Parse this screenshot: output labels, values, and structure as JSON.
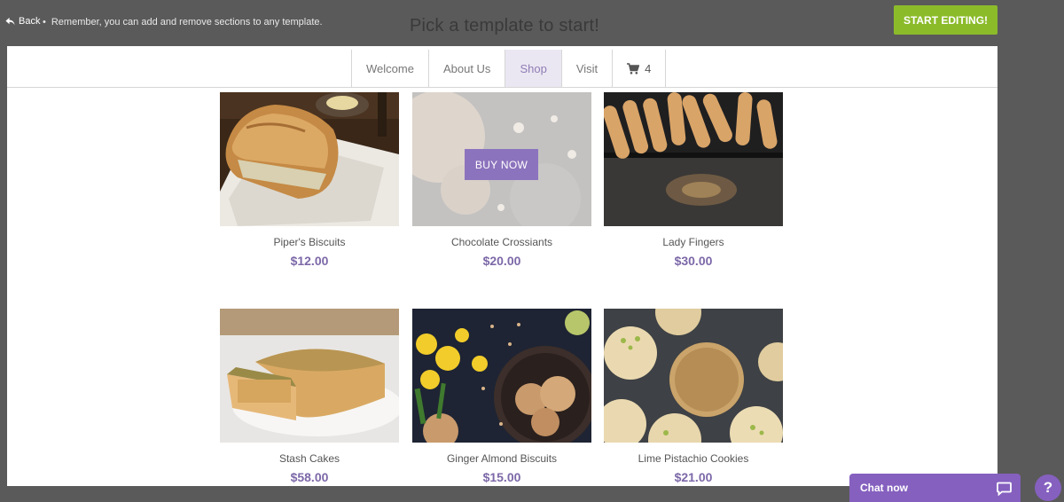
{
  "topbar": {
    "back_label": "Back",
    "hint_bullet": "•",
    "hint_text": "Remember, you can add and remove sections to any template.",
    "heading": "Pick a template to start!",
    "start_button": "START EDITING!"
  },
  "nav": {
    "items": [
      {
        "label": "Welcome"
      },
      {
        "label": "About Us"
      },
      {
        "label": "Shop"
      },
      {
        "label": "Visit"
      }
    ],
    "active": "Shop",
    "cart_count": "4"
  },
  "products": [
    {
      "name": "Piper's Biscuits",
      "price": "$12.00"
    },
    {
      "name": "Chocolate Crossiants",
      "price": "$20.00",
      "overlay_button": "BUY NOW"
    },
    {
      "name": "Lady Fingers",
      "price": "$30.00"
    },
    {
      "name": "Stash Cakes",
      "price": "$58.00"
    },
    {
      "name": "Ginger Almond Biscuits",
      "price": "$15.00"
    },
    {
      "name": "Lime Pistachio Cookies",
      "price": "$21.00"
    }
  ],
  "chat": {
    "label": "Chat now"
  },
  "help": {
    "label": "?"
  },
  "colors": {
    "accent": "#8560bf",
    "start_button": "#8cbb2a",
    "price": "#7c68a8"
  }
}
